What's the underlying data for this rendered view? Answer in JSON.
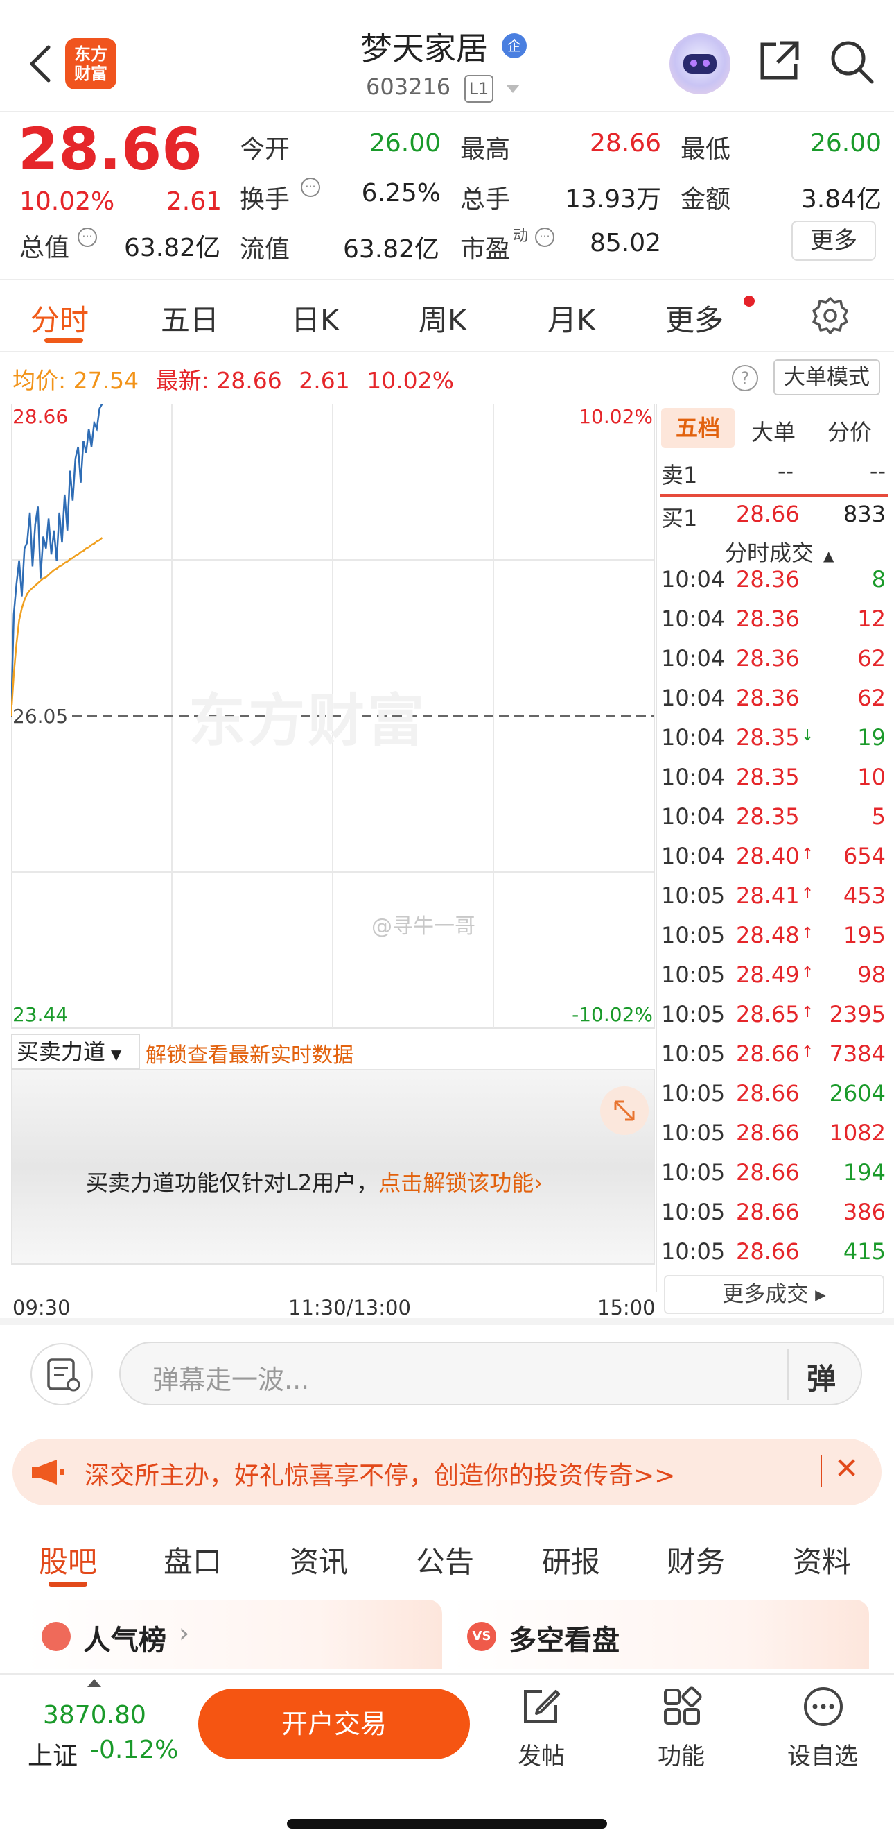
{
  "header": {
    "title": "梦天家居",
    "title_badge": "企",
    "code": "603216",
    "level": "L1",
    "brand_logo": "东方\n财富"
  },
  "quote": {
    "price": "28.66",
    "change_pct": "10.02%",
    "change": "2.61",
    "stats": [
      {
        "label": "今开",
        "value": "26.00",
        "color": "green"
      },
      {
        "label": "最高",
        "value": "28.66",
        "color": "red"
      },
      {
        "label": "最低",
        "value": "26.00",
        "color": "green"
      },
      {
        "label": "换手",
        "value": "6.25%",
        "color": "dark"
      },
      {
        "label": "总手",
        "value": "13.93万",
        "color": "dark"
      },
      {
        "label": "金额",
        "value": "3.84亿",
        "color": "dark"
      },
      {
        "label": "总值",
        "value": "63.82亿",
        "color": "dark"
      },
      {
        "label": "流值",
        "value": "63.82亿",
        "color": "dark"
      },
      {
        "label": "市盈",
        "label_sup": "动",
        "value": "85.02",
        "color": "dark"
      }
    ],
    "more_label": "更多"
  },
  "chart_tabs": [
    "分时",
    "五日",
    "日K",
    "周K",
    "月K",
    "更多"
  ],
  "chart_info": {
    "avg_label": "均价:",
    "avg": "27.54",
    "latest_label": "最新:",
    "latest": "28.66",
    "change": "2.61",
    "pct": "10.02%",
    "help": "?",
    "mode_button": "大单模式"
  },
  "chart_data": {
    "type": "line",
    "title": "",
    "x_ticks": [
      "09:30",
      "11:30/13:00",
      "15:00"
    ],
    "ylim": [
      23.44,
      28.66
    ],
    "ref_price": 26.05,
    "y_labels": {
      "top": "28.66",
      "ref": "26.05",
      "bottom": "23.44",
      "top_pct": "10.02%",
      "bottom_pct": "-10.02%"
    },
    "watermark": "东方财富",
    "credit": "@寻牛一哥",
    "series": [
      {
        "color": "#2f6db5",
        "x": [
          0,
          1,
          2,
          3,
          4,
          5,
          6,
          7,
          8,
          9,
          10,
          11,
          12,
          13,
          14,
          15,
          16,
          17,
          18,
          19,
          20,
          21,
          22,
          23,
          24,
          25,
          26,
          27,
          28,
          29,
          30,
          31,
          32,
          33,
          34
        ],
        "values": [
          26.05,
          26.9,
          27.15,
          27.35,
          27.05,
          27.45,
          27.5,
          27.75,
          27.3,
          27.65,
          27.8,
          27.2,
          27.55,
          27.45,
          27.7,
          27.4,
          27.6,
          27.35,
          27.75,
          27.5,
          27.9,
          27.6,
          28.1,
          27.85,
          28.2,
          28.3,
          28.0,
          28.35,
          28.25,
          28.45,
          28.3,
          28.5,
          28.45,
          28.62,
          28.66
        ]
      },
      {
        "color": "#f0a020",
        "x": [
          0,
          1,
          2,
          3,
          4,
          5,
          6,
          7,
          8,
          9,
          10,
          11,
          12,
          13,
          14,
          15,
          16,
          17,
          18,
          19,
          20,
          21,
          22,
          23,
          24,
          25,
          26,
          27,
          28,
          29,
          30,
          31,
          32,
          33,
          34
        ],
        "values": [
          26.05,
          26.4,
          26.65,
          26.85,
          26.95,
          27.02,
          27.07,
          27.1,
          27.12,
          27.14,
          27.16,
          27.18,
          27.2,
          27.21,
          27.23,
          27.25,
          27.27,
          27.28,
          27.3,
          27.31,
          27.33,
          27.34,
          27.36,
          27.37,
          27.39,
          27.4,
          27.42,
          27.43,
          27.45,
          27.46,
          27.48,
          27.49,
          27.51,
          27.52,
          27.54
        ]
      }
    ]
  },
  "side_panel": {
    "tabs": [
      "五档",
      "大单",
      "分价"
    ],
    "sell": {
      "label": "卖1",
      "price": "--",
      "vol": "--"
    },
    "buy": {
      "label": "买1",
      "price": "28.66",
      "vol": "833"
    },
    "trades_title": "分时成交",
    "trades": [
      {
        "t": "10:04",
        "p": "28.36",
        "a": "",
        "v": "8",
        "vc": "green"
      },
      {
        "t": "10:04",
        "p": "28.36",
        "a": "",
        "v": "12",
        "vc": "red"
      },
      {
        "t": "10:04",
        "p": "28.36",
        "a": "",
        "v": "62",
        "vc": "red"
      },
      {
        "t": "10:04",
        "p": "28.36",
        "a": "",
        "v": "62",
        "vc": "red"
      },
      {
        "t": "10:04",
        "p": "28.35",
        "a": "↓",
        "v": "19",
        "vc": "green"
      },
      {
        "t": "10:04",
        "p": "28.35",
        "a": "",
        "v": "10",
        "vc": "red"
      },
      {
        "t": "10:04",
        "p": "28.35",
        "a": "",
        "v": "5",
        "vc": "red"
      },
      {
        "t": "10:04",
        "p": "28.40",
        "a": "↑",
        "v": "654",
        "vc": "red"
      },
      {
        "t": "10:05",
        "p": "28.41",
        "a": "↑",
        "v": "453",
        "vc": "red"
      },
      {
        "t": "10:05",
        "p": "28.48",
        "a": "↑",
        "v": "195",
        "vc": "red"
      },
      {
        "t": "10:05",
        "p": "28.49",
        "a": "↑",
        "v": "98",
        "vc": "red"
      },
      {
        "t": "10:05",
        "p": "28.65",
        "a": "↑",
        "v": "2395",
        "vc": "red"
      },
      {
        "t": "10:05",
        "p": "28.66",
        "a": "↑",
        "v": "7384",
        "vc": "red"
      },
      {
        "t": "10:05",
        "p": "28.66",
        "a": "",
        "v": "2604",
        "vc": "green"
      },
      {
        "t": "10:05",
        "p": "28.66",
        "a": "",
        "v": "1082",
        "vc": "red"
      },
      {
        "t": "10:05",
        "p": "28.66",
        "a": "",
        "v": "194",
        "vc": "green"
      },
      {
        "t": "10:05",
        "p": "28.66",
        "a": "",
        "v": "386",
        "vc": "red"
      },
      {
        "t": "10:05",
        "p": "28.66",
        "a": "",
        "v": "415",
        "vc": "green"
      }
    ],
    "more_trades": "更多成交"
  },
  "lower": {
    "select_label": "买卖力道",
    "unlock_link": "解锁查看最新实时数据",
    "notice": "买卖力道功能仅针对L2用户，",
    "notice_link": "点击解锁该功能"
  },
  "danmu": {
    "placeholder": "弹幕走一波...",
    "toggle": "弹"
  },
  "banner": {
    "text": "深交所主办，好礼惊喜享不停，创造你的投资传奇>>"
  },
  "bottom_tabs": [
    "股吧",
    "盘口",
    "资讯",
    "公告",
    "研报",
    "财务",
    "资料"
  ],
  "cards": [
    {
      "title": "人气榜"
    },
    {
      "title": "多空看盘"
    }
  ],
  "dock": {
    "index_value": "3870.80",
    "index_name": "上证",
    "index_change": "-0.12%",
    "trade_button": "开户交易",
    "actions": [
      "发帖",
      "功能",
      "设自选"
    ]
  }
}
